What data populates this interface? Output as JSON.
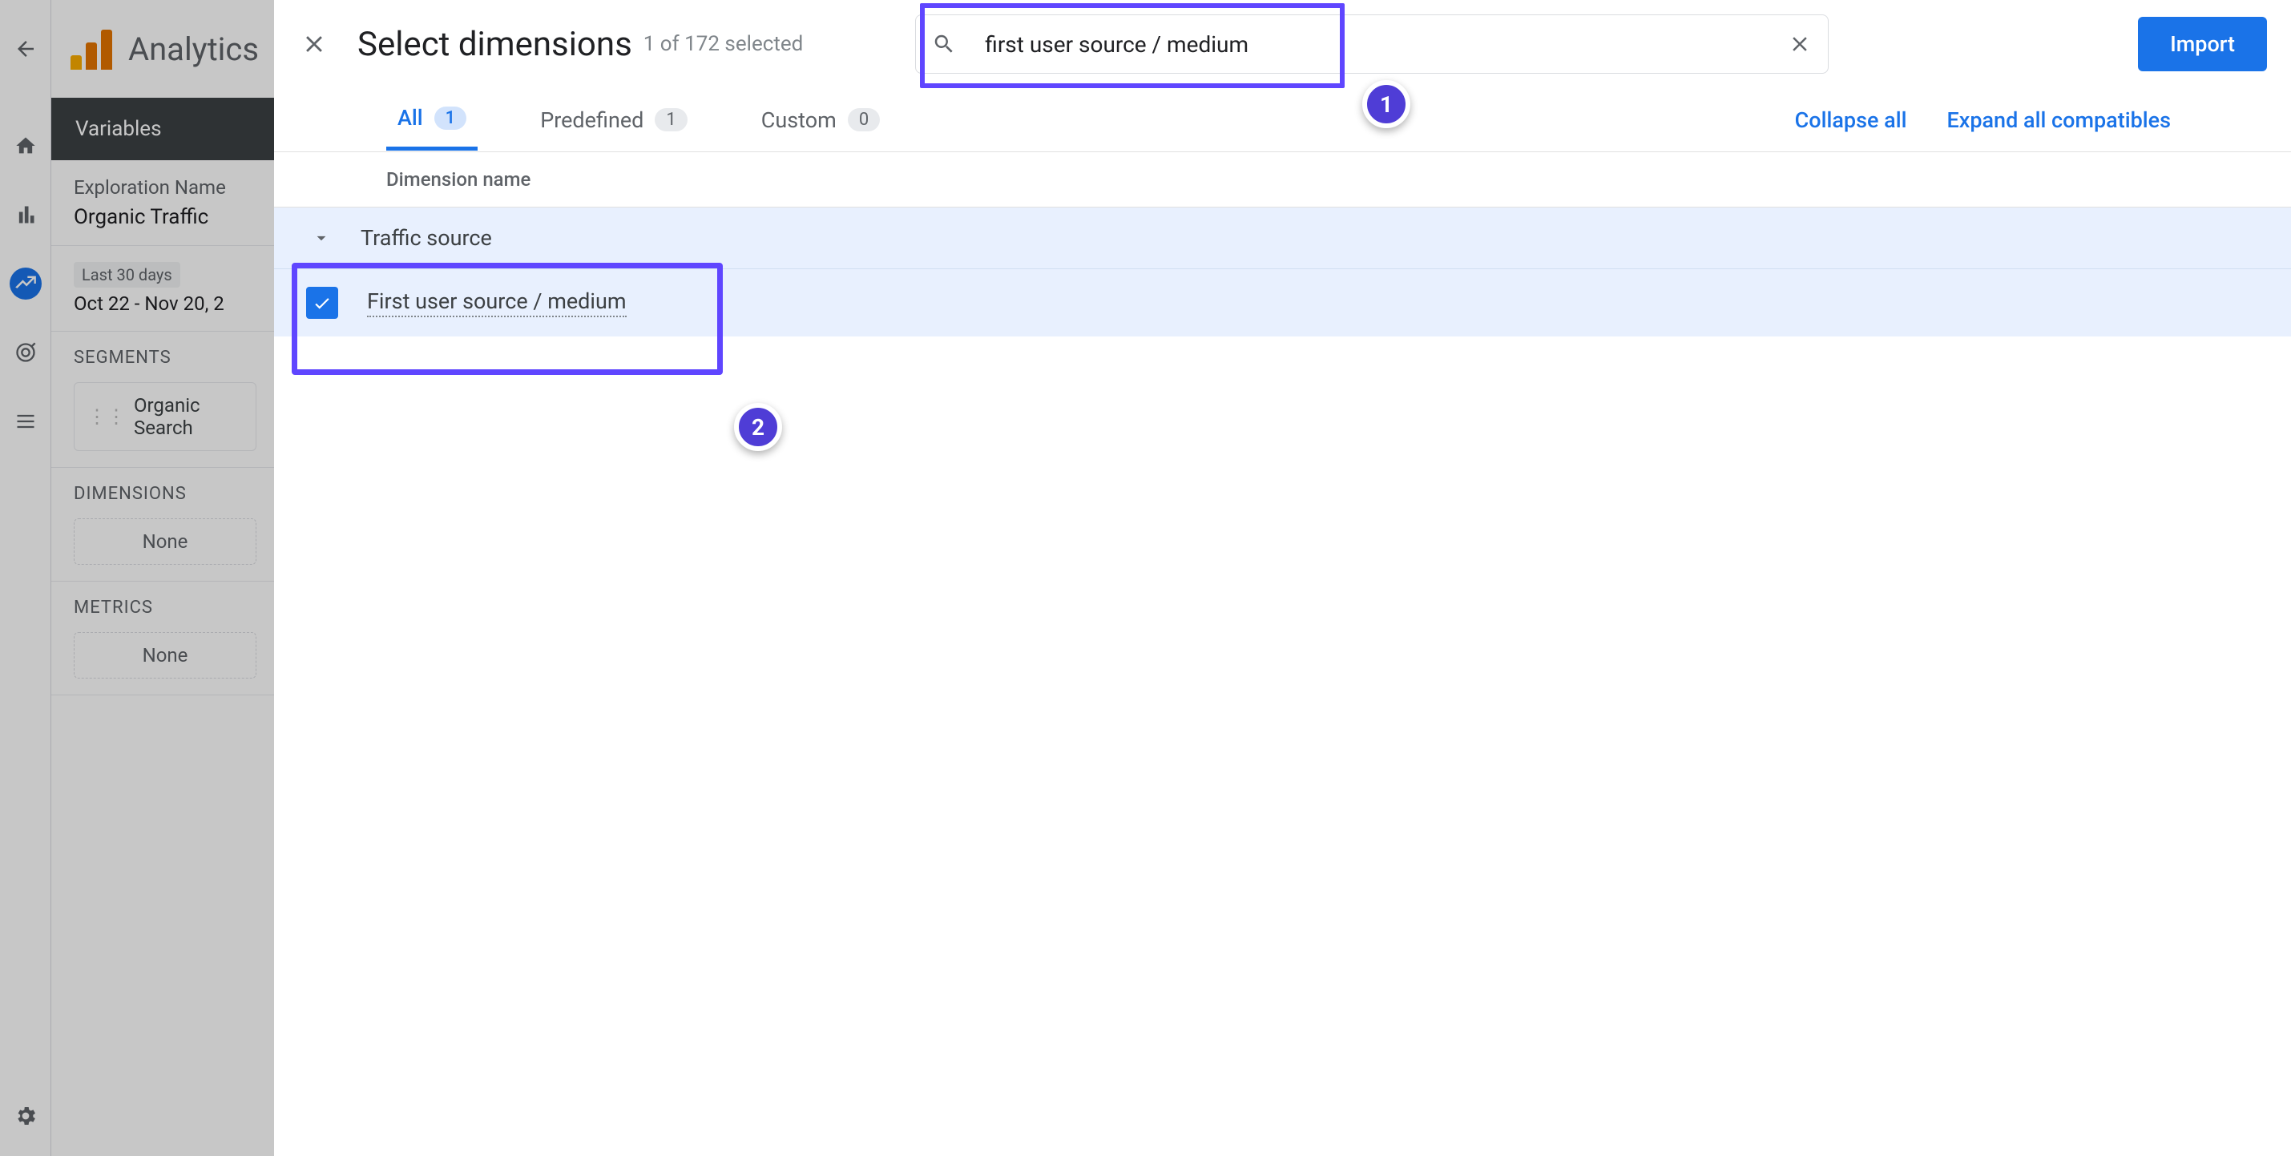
{
  "header": {
    "app_name": "Analytics"
  },
  "variables_panel": {
    "title": "Variables",
    "exploration_label": "Exploration Name",
    "exploration_name": "Organic Traffic",
    "date_chip": "Last 30 days",
    "date_range": "Oct 22 - Nov 20, 2",
    "segments": {
      "heading": "SEGMENTS",
      "chip": "Organic Search"
    },
    "dimensions": {
      "heading": "DIMENSIONS",
      "placeholder": "None"
    },
    "metrics": {
      "heading": "METRICS",
      "placeholder": "None"
    }
  },
  "modal": {
    "title": "Select dimensions",
    "count": "1 of 172 selected",
    "search_value": "first user source / medium",
    "import_label": "Import",
    "tabs": {
      "all": {
        "label": "All",
        "count": "1"
      },
      "predefined": {
        "label": "Predefined",
        "count": "1"
      },
      "custom": {
        "label": "Custom",
        "count": "0"
      }
    },
    "collapse_label": "Collapse all",
    "expand_label": "Expand all compatibles",
    "column_header": "Dimension name",
    "group_name": "Traffic source",
    "item_name": "First user source / medium"
  },
  "annotations": {
    "badge1": "1",
    "badge2": "2"
  }
}
